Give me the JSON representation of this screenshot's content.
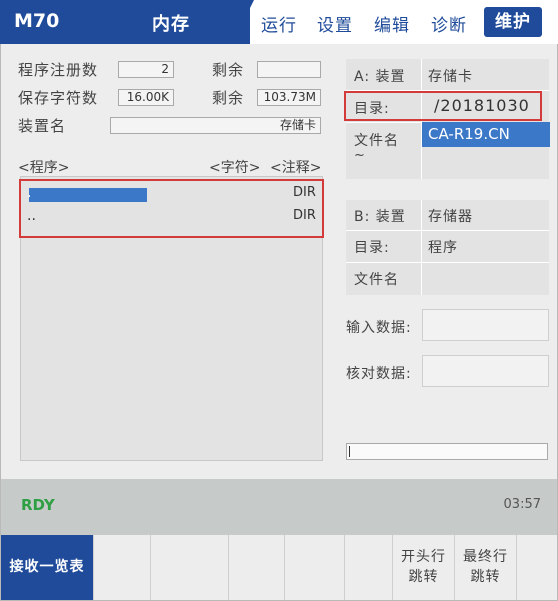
{
  "header": {
    "model": "M70",
    "title": "内存",
    "menu": [
      "运行",
      "设置",
      "编辑",
      "诊断"
    ],
    "active_menu": "维护"
  },
  "summary": {
    "registered_label": "程序注册数",
    "registered_value": "2",
    "remaining1_label": "剩余",
    "remaining1_value": "",
    "saved_chars_label": "保存字符数",
    "saved_chars_value": "16.00K",
    "remaining2_label": "剩余",
    "remaining2_value": "103.73M",
    "device_name_label": "装置名",
    "device_name_value": "存储卡"
  },
  "list": {
    "col_program": "<程序>",
    "col_chars": "<字符>",
    "col_comment": "<注释>",
    "rows": [
      {
        "name": ".",
        "type": "DIR"
      },
      {
        "name": "..",
        "type": "DIR"
      }
    ]
  },
  "panel_a": {
    "device_label": "A: 装置",
    "device_value": "存储卡",
    "dir_label": "目录:",
    "dir_value": "/20181030",
    "file_label": "文件名",
    "file_value": "CA-R19.CN",
    "tilde": "~"
  },
  "panel_b": {
    "device_label": "B: 装置",
    "device_value": "存储器",
    "dir_label": "目录:",
    "dir_value": "程序",
    "file_label": "文件名",
    "file_value": ""
  },
  "data_fields": {
    "input_label": "输入数据:",
    "verify_label": "核对数据:"
  },
  "status": {
    "state": "RDY",
    "time": "03:57"
  },
  "softkeys": {
    "receive_list": "接收一览表",
    "jump_first_l1": "开头行",
    "jump_first_l2": "跳转",
    "jump_last_l1": "最终行",
    "jump_last_l2": "跳转"
  },
  "colors": {
    "brand_blue": "#1f4b9a",
    "selection_blue": "#3b78c8",
    "highlight_red": "#d33a3a",
    "status_green": "#2ea043"
  }
}
